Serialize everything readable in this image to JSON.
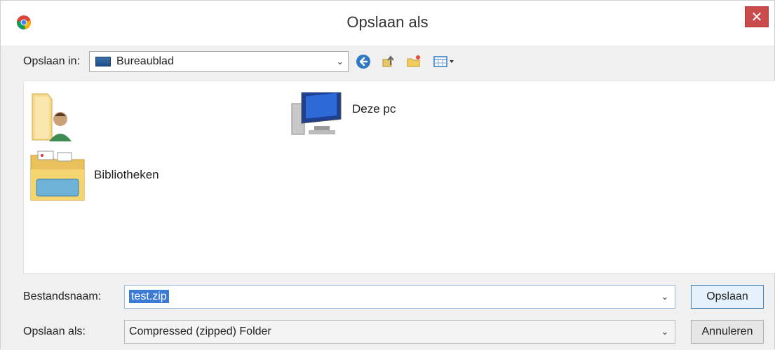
{
  "window": {
    "title": "Opslaan als"
  },
  "toolbar": {
    "save_in_label": "Opslaan in:",
    "location": "Bureaublad"
  },
  "items": [
    {
      "label": "",
      "icon": "user-folder-icon"
    },
    {
      "label": "Deze pc",
      "icon": "computer-icon"
    },
    {
      "label": "Bibliotheken",
      "icon": "libraries-folder-icon"
    }
  ],
  "form": {
    "filename_label": "Bestandsnaam:",
    "filename_value": "test.zip",
    "type_label": "Opslaan als:",
    "type_value": "Compressed (zipped) Folder"
  },
  "buttons": {
    "save": "Opslaan",
    "cancel": "Annuleren"
  },
  "colors": {
    "close_red": "#c94b4b",
    "selection_blue": "#3b7bd6",
    "primary_button_border": "#3c7fb1"
  }
}
